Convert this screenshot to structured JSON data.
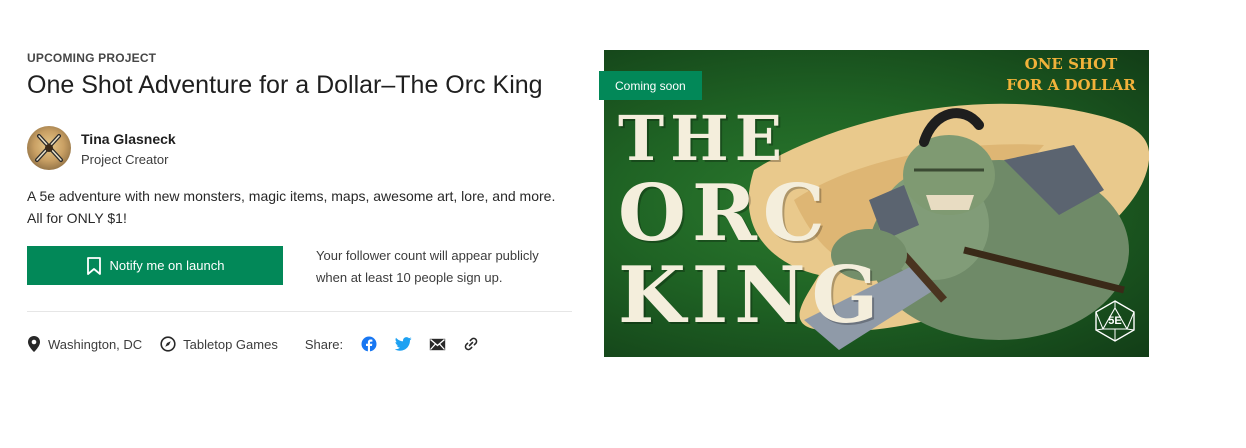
{
  "project": {
    "eyebrow": "UPCOMING PROJECT",
    "title": "One Shot Adventure for a Dollar–The Orc King",
    "description": "A 5e adventure with new monsters, magic items, maps, awesome art, lore, and more. All for ONLY $1!"
  },
  "creator": {
    "name": "Tina Glasneck",
    "role": "Project Creator"
  },
  "notify": {
    "label": "Notify me on launch",
    "icon": "bookmark-icon",
    "note": "Your follower count will appear publicly when at least 10 people sign up."
  },
  "meta": {
    "location": "Washington, DC",
    "location_icon": "map-pin-icon",
    "category": "Tabletop Games",
    "category_icon": "compass-icon",
    "share_label": "Share:",
    "share_icons": [
      "facebook-icon",
      "twitter-icon",
      "email-icon",
      "link-icon"
    ]
  },
  "hero": {
    "badge": "Coming soon",
    "word_the": "THE",
    "word_orc": "ORC",
    "word_king": "KING",
    "tagline_line1": "ONE SHOT",
    "tagline_line2": "FOR A DOLLAR",
    "dice_label": "5E"
  },
  "colors": {
    "brand_green": "#028858",
    "hero_green": "#1f6324",
    "tagline_gold": "#f2b23a"
  }
}
